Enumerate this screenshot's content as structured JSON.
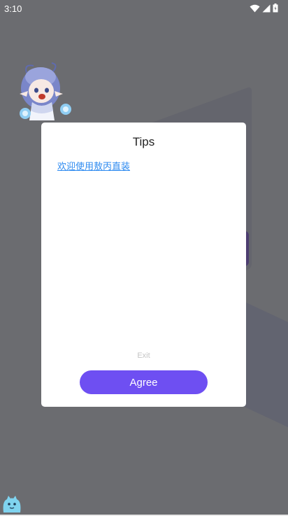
{
  "status_bar": {
    "time": "3:10",
    "icons": [
      "wifi-icon",
      "cellular-signal-icon",
      "battery-icon"
    ]
  },
  "dialog": {
    "title": "Tips",
    "link_text": "欢迎使用敖丙直装",
    "exit_label": "Exit",
    "agree_label": "Agree"
  },
  "colors": {
    "overlay": "#6b6c70",
    "dialog_bg": "#ffffff",
    "link": "#2f8bf0",
    "accent": "#6e4ff2",
    "exit_text": "#c4c4c4"
  }
}
